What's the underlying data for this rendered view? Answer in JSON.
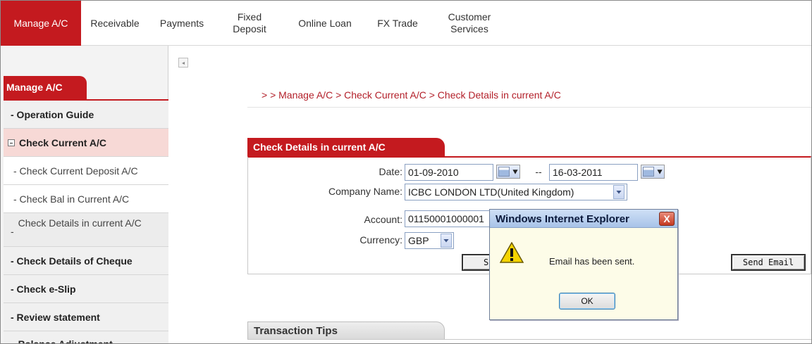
{
  "nav": {
    "items": [
      {
        "label": "Manage A/C",
        "active": true
      },
      {
        "label": "Receivable"
      },
      {
        "label": "Payments"
      },
      {
        "label": "Fixed\nDeposit"
      },
      {
        "label": "Online Loan"
      },
      {
        "label": "FX Trade"
      },
      {
        "label": "Customer\nServices"
      }
    ],
    "accent_color": "#c41a1f"
  },
  "sidebar": {
    "header": "Manage A/C",
    "items": [
      {
        "label": "- Operation Guide"
      },
      {
        "label": "Check Current A/C"
      },
      {
        "label": "- Check Current Deposit A/C"
      },
      {
        "label": "- Check Bal in Current A/C"
      },
      {
        "label": "Check Details in current A/C"
      },
      {
        "label": "- Check Details of Cheque"
      },
      {
        "label": "- Check e-Slip"
      },
      {
        "label": "- Review statement"
      },
      {
        "label": "Balance Adjustment"
      }
    ]
  },
  "breadcrumb": "> > Manage A/C > Check Current A/C > Check Details in current A/C",
  "panel": {
    "title": "Check Details in current A/C",
    "date_label": "Date:",
    "date_from": "01-09-2010",
    "date_sep": "--",
    "date_to": "16-03-2011",
    "company_label": "Company Name:",
    "company_value": "ICBC LONDON LTD(United Kingdom)",
    "account_label": "Account:",
    "account_value": "01150001000001",
    "currency_label": "Currency:",
    "currency_value": "GBP",
    "search_button_partial": "Se",
    "send_email_button": "Send Email"
  },
  "tips": {
    "title": "Transaction Tips"
  },
  "dialog": {
    "title": "Windows Internet Explorer",
    "close": "X",
    "message": "Email has been sent.",
    "ok_label": "OK",
    "icon": "warning-icon"
  }
}
